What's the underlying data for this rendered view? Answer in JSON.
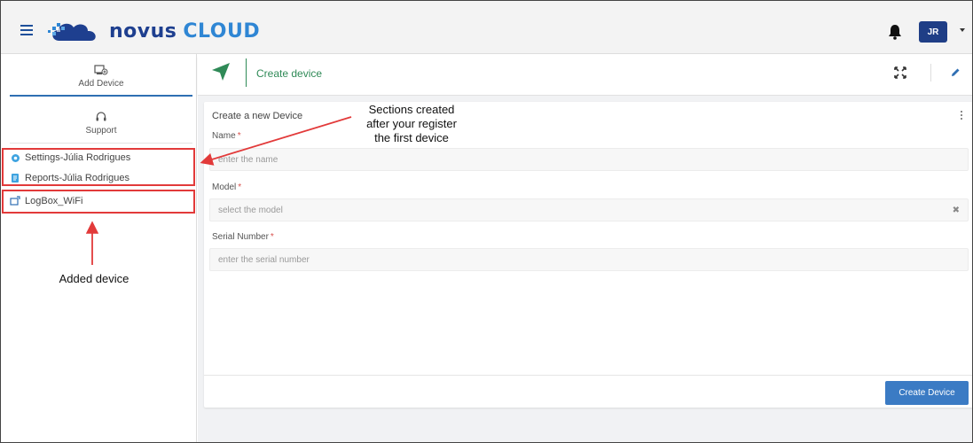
{
  "brand": {
    "name_part1": "novus",
    "name_part2": "CLOUD"
  },
  "user": {
    "initials": "JR"
  },
  "sidebar": {
    "add_device": {
      "label": "Add Device",
      "icon": "add-device-icon"
    },
    "support": {
      "label": "Support",
      "icon": "headset-icon"
    },
    "items": [
      {
        "label": "Settings-Júlia Rodrigues",
        "icon": "gear-icon"
      },
      {
        "label": "Reports-Júlia Rodrigues",
        "icon": "report-icon"
      },
      {
        "label": "LogBox_WiFi",
        "icon": "device-icon"
      }
    ]
  },
  "header": {
    "title": "Create device"
  },
  "form": {
    "title": "Create a new Device",
    "name": {
      "label": "Name",
      "placeholder": "enter the name"
    },
    "model": {
      "label": "Model",
      "placeholder": "select the model",
      "clear": "✖"
    },
    "serial": {
      "label": "Serial Number",
      "placeholder": "enter the serial number"
    },
    "required_mark": "*",
    "submit_label": "Create Device"
  },
  "annotations": {
    "sections_note_line1": "Sections created",
    "sections_note_line2": "after your register",
    "sections_note_line3": "the first device",
    "added_device_note": "Added device"
  },
  "colors": {
    "brand_dark": "#1e3f8f",
    "brand_light": "#2f86d4",
    "accent_green": "#2f8a57",
    "primary_button": "#3b7bc4",
    "annotation_red": "#e23a3a"
  }
}
